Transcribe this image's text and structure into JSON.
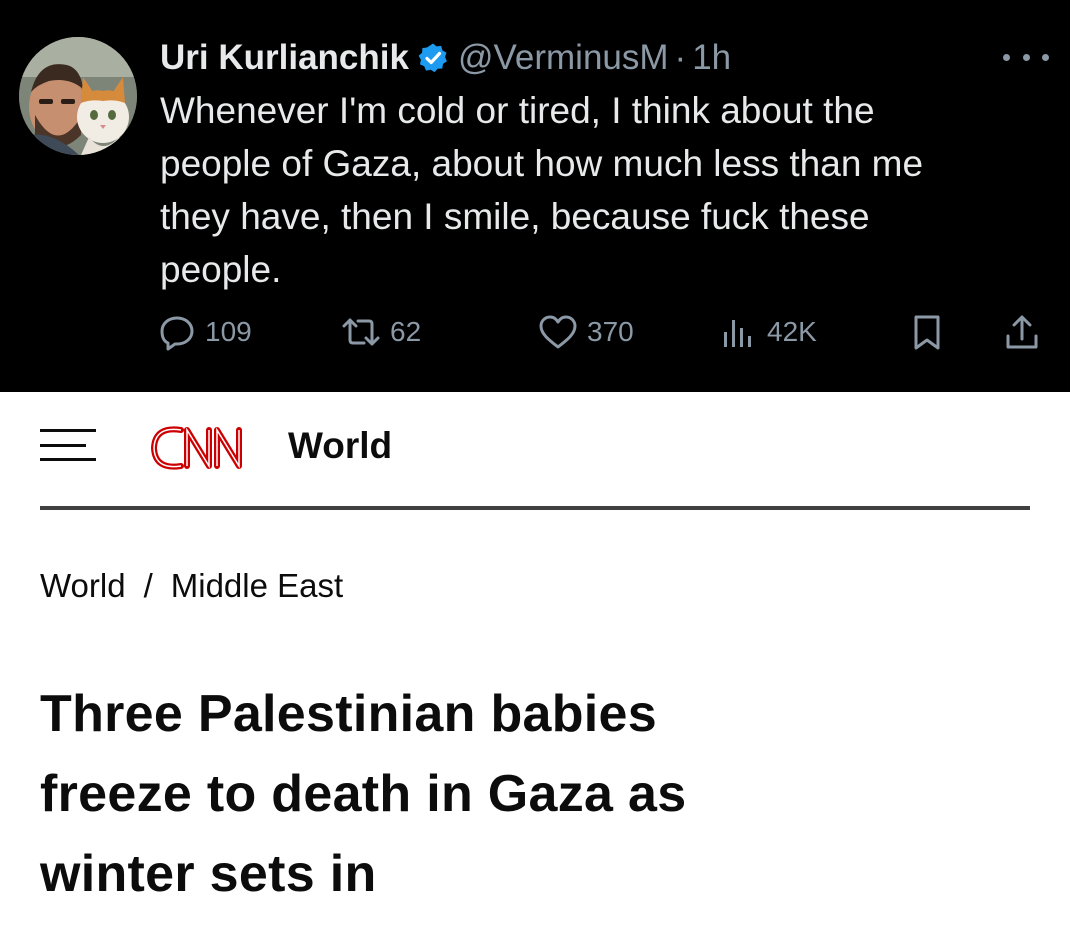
{
  "tweet": {
    "author_name": "Uri Kurlianchik",
    "handle": "@VerminusM",
    "separator": "·",
    "time": "1h",
    "text_lines": [
      "Whenever I'm cold or tired, I think about the",
      "people of Gaza, about how much less than me",
      "they have, then I smile, because fuck these",
      "people."
    ],
    "replies": "109",
    "reposts": "62",
    "likes": "370",
    "views": "42K",
    "colors": {
      "background": "#000000",
      "verified": "#1d9bf0",
      "muted": "#8b98a5"
    },
    "icons": [
      "verified-badge-icon",
      "more-options-icon",
      "reply-icon",
      "repost-icon",
      "like-icon",
      "views-icon",
      "bookmark-icon",
      "share-icon"
    ]
  },
  "cnn": {
    "logo_text": "CNN",
    "section": "World",
    "breadcrumb": {
      "first": "World",
      "separator": "/",
      "second": "Middle East"
    },
    "headline_lines": [
      "Three Palestinian babies",
      "freeze to death in Gaza as",
      "winter sets in"
    ],
    "colors": {
      "brand": "#cc0000",
      "text": "#0c0c0c"
    },
    "icons": [
      "menu-icon"
    ]
  }
}
